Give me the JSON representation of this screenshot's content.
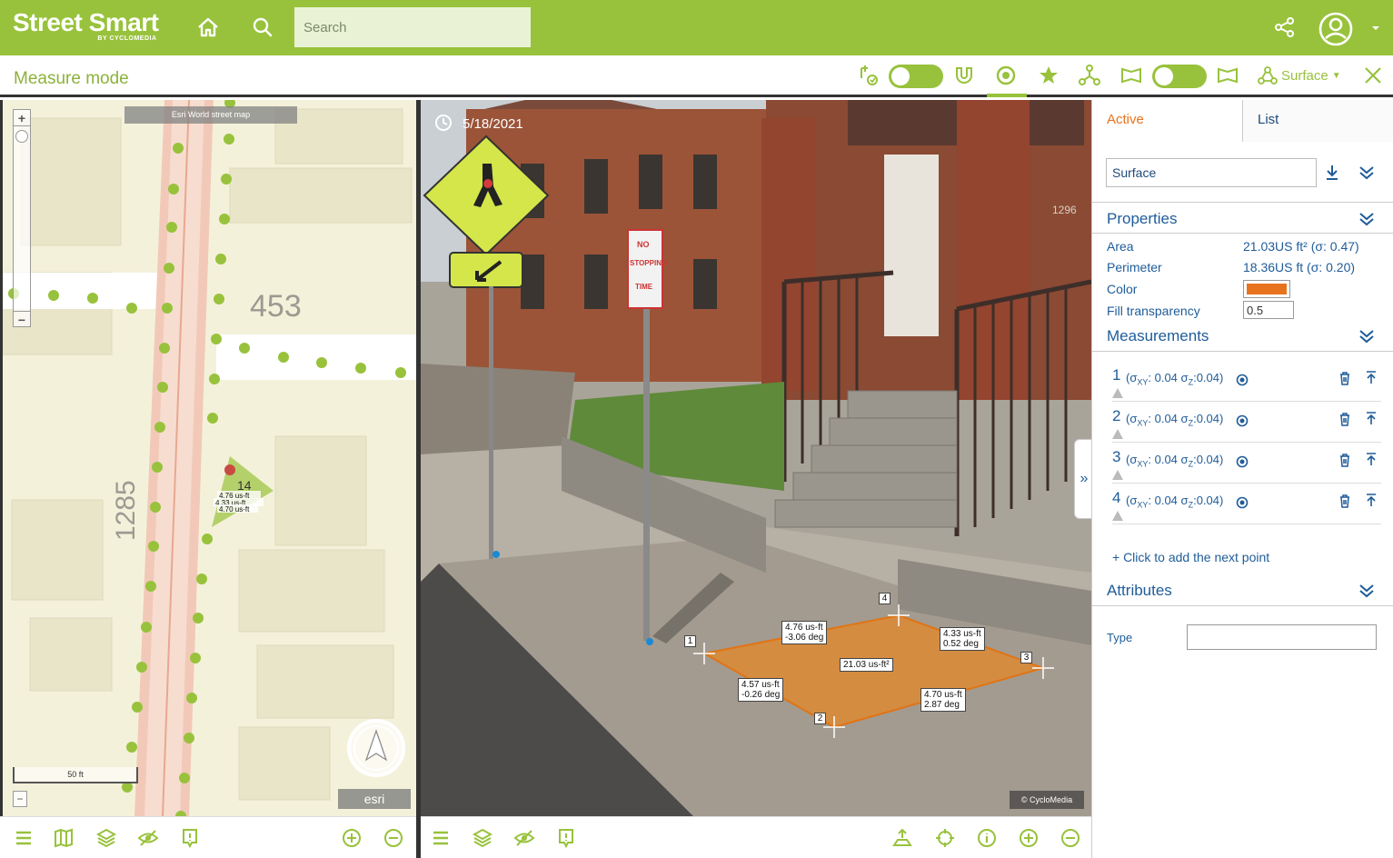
{
  "app": {
    "brand_name": "Street Smart",
    "brand_sub": "BY CYCLOMEDIA",
    "search_placeholder": "Search"
  },
  "modebar": {
    "title": "Measure mode",
    "surface_label": "Surface",
    "colors": {
      "accent": "#98c23c"
    }
  },
  "map": {
    "layer_label": "Esri World street map",
    "scale_label": "50 ft",
    "provider": "esri",
    "street_number_1": "453",
    "street_number_2": "1285",
    "badge": "14",
    "overlay_l1": "4.76 us-ft",
    "overlay_l2": "4.33 us-ft",
    "overlay_l3": "4.70 us-ft"
  },
  "photo": {
    "date": "5/18/2021",
    "copyright": "© CycloMedia",
    "sign_text": [
      "NO",
      "STOPPING",
      "TIME"
    ],
    "house_number": "1296",
    "measurement_labels": {
      "edge_1_4": [
        "4.76 us-ft",
        "-3.06 deg"
      ],
      "edge_4_3": [
        "4.33 us-ft",
        "0.52 deg"
      ],
      "area": "21.03 us-ft²",
      "edge_1_2": [
        "4.57 us-ft",
        "-0.26 deg"
      ],
      "edge_2_3": [
        "4.70 us-ft",
        "2.87 deg"
      ]
    },
    "points": [
      "1",
      "2",
      "3",
      "4"
    ],
    "fill_color": "#e8861f"
  },
  "panel": {
    "tab_active": "Active",
    "tab_list": "List",
    "measurement_name": "Surface",
    "properties_title": "Properties",
    "properties": [
      {
        "key": "Area",
        "value": "21.03US ft² (σ: 0.47)"
      },
      {
        "key": "Perimeter",
        "value": "18.36US ft (σ: 0.20)"
      },
      {
        "key": "Color",
        "value": ""
      },
      {
        "key": "Fill transparency",
        "value": ""
      }
    ],
    "color_value": "#e8731e",
    "fill_transparency": "0.5",
    "measurements_title": "Measurements",
    "measurements": [
      {
        "num": "1",
        "sxy": "0.04",
        "sz": "0.04"
      },
      {
        "num": "2",
        "sxy": "0.04",
        "sz": "0.04"
      },
      {
        "num": "3",
        "sxy": "0.04",
        "sz": "0.04"
      },
      {
        "num": "4",
        "sxy": "0.04",
        "sz": "0.04"
      }
    ],
    "sigma_xy_prefix": "(σ",
    "sigma_xy_sub": "XY",
    "sigma_z": "σ",
    "sigma_z_sub": "Z",
    "add_point": "+ Click to add the next point",
    "attributes_title": "Attributes",
    "type_label": "Type"
  }
}
